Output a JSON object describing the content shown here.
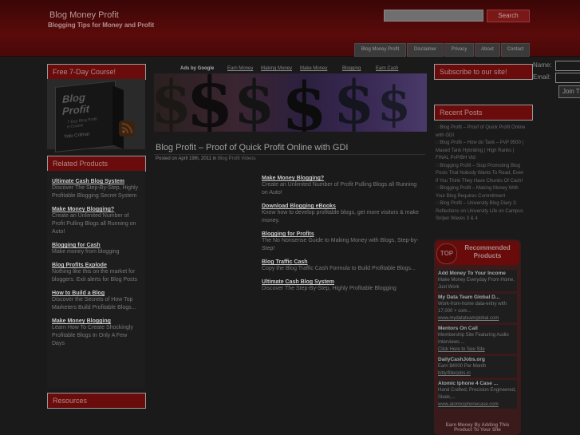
{
  "header": {
    "site_title": "Blog Money Profit",
    "tagline": "Blogging Tips for Money and Profit",
    "search_button": "Search",
    "search_placeholder": "",
    "nav": [
      "Blog Money Profit",
      "Disclaimer",
      "Privacy",
      "About",
      "Contact"
    ]
  },
  "left": {
    "course_title": "Free 7-Day Course!",
    "course_image": {
      "brand": "Blog Profit",
      "sub": "7-Day Blog Profit e-Course",
      "name": "Yolo Crilmar"
    },
    "related_title": "Related Products",
    "related": [
      {
        "title": "Ultimate Cash Blog System",
        "text": "Discover The Step-By-Step, Highly Profitable Blogging Secret System"
      },
      {
        "title": "Make Money Blogging?",
        "text": "Create an Unlimited Number of Profit Pulling Blogs all Running on Auto!"
      },
      {
        "title": "Blogging for Cash",
        "text": "Make money from blogging"
      },
      {
        "title": "Blog Profits Explode",
        "text": "Nothing like this on the market for bloggers. Exit alerts for Blog Posts"
      },
      {
        "title": "How to Build a Blog",
        "text": "Discover the Secrets of How Top Marketers Build Profitable Blogs..."
      },
      {
        "title": "Make Money Blogging",
        "text": "Learn How To Create Shockingly Profitable Blogs In Only A Few Days"
      }
    ],
    "resources_title": "Resources"
  },
  "main": {
    "ads_label": "Ads by Google",
    "ad_links": [
      "Earn Money",
      "Making Money",
      "Make Money",
      "Blogging",
      "Earn Cash"
    ],
    "post_title": "Blog Profit – Proof of Quick Profit Online with GDI",
    "post_meta_prefix": "Posted on April 19th, 2011 in",
    "post_category": "Blog Profit Videos",
    "links": [
      {
        "title": "Make Money Blogging?",
        "text": "Create an Unlimited Number of Profit Pulling Blogs all Running on Auto!"
      },
      {
        "title": "Download Blogging eBooks",
        "text": "Know how to develop profitable blogs, get more visitors & make money."
      },
      {
        "title": "Blogging for Profits",
        "text": "The No Nonsense Guide to Making Money with Blogs, Step-by-Step!"
      },
      {
        "title": "Blog Traffic Cash",
        "text": "Copy the Blog Traffic Cash Formula to Build Profitable Blogs..."
      },
      {
        "title": "Ultimate Cash Blog System",
        "text": "Discover The Step-By-Step, Highly Profitable Blogging"
      }
    ]
  },
  "right": {
    "subscribe_title": "Subscribe to our site!",
    "form_name_label": "Name:",
    "form_email_label": "Email:",
    "form_button": "Join T",
    "recent_title": "Recent Posts",
    "recent_posts": [
      "Blog Profit – Proof of Quick Profit Online with GDI",
      "Blog Profit – How do Tank – PvP 9500 | Maxed Tank Hybriding | High Ranks | FINAL PvP/BH Vid",
      "Blogging Profit – Stop Promoting Blog Posts That Nobody Wants To Read, Even If You Think They Have Chunks Of Cash!",
      "Blogging Profit – Making Money With Your Blog Requires Commitment",
      "Blog Profit – University Blog Diary 3: Reflections on University Life on Campus Sniper Waves 3 & 4"
    ],
    "rec_badge": "TOP",
    "rec_heading": "Recommended Products",
    "rec_items": [
      {
        "title": "Add Money To Your Income",
        "text": "Make Money Everyday From Home, Just Work"
      },
      {
        "title": "My Data Team Global D...",
        "text": "Work-from-home data-entry with 17,000 + com...",
        "url": "www.mydatateamglobal.com"
      },
      {
        "title": "Mentors On Call",
        "text": "Membership Site Featuring Audio Interviews ...",
        "url": "Click Here to See Site"
      },
      {
        "title": "DailyCashJobs.org",
        "text": "Earn $4000 Per Month",
        "url": "bitly/fillerjobs.in"
      },
      {
        "title": "Atomic Iphone 4 Case ...",
        "text": "Hand Crafted, Precision Engineered, Sleek,...",
        "url": "www.atomiciphonecase.com"
      }
    ],
    "rec_footer": "Earn Money By Adding This Product To Your Site"
  }
}
